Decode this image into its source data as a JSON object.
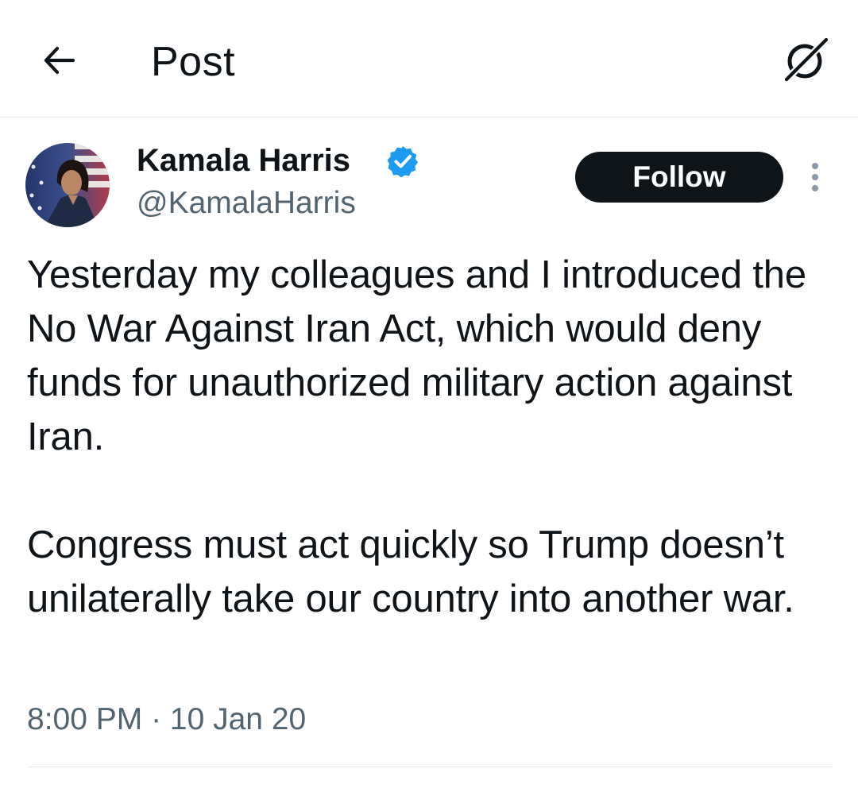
{
  "header": {
    "back_icon": "arrow-left-icon",
    "title": "Post",
    "grok_icon": "grok-icon"
  },
  "author": {
    "display_name": "Kamala Harris",
    "handle": "@KamalaHarris",
    "verified": true,
    "verified_color": "#1d9bf0",
    "avatar_icon": "avatar"
  },
  "actions": {
    "follow_label": "Follow",
    "more_icon": "more-vertical-icon"
  },
  "post": {
    "text": "Yesterday my colleagues and I introduced the No War Against Iran Act, which would deny funds for unauthorized military action against Iran.\n\nCongress must act quickly so Trump doesn’t unilaterally take our country into another war.",
    "timestamp": "8:00 PM · 10 Jan 20"
  },
  "colors": {
    "text_primary": "#0f1419",
    "text_secondary": "#536471",
    "follow_bg": "#0f1419",
    "follow_text": "#ffffff",
    "divider": "#e6e9ec"
  }
}
